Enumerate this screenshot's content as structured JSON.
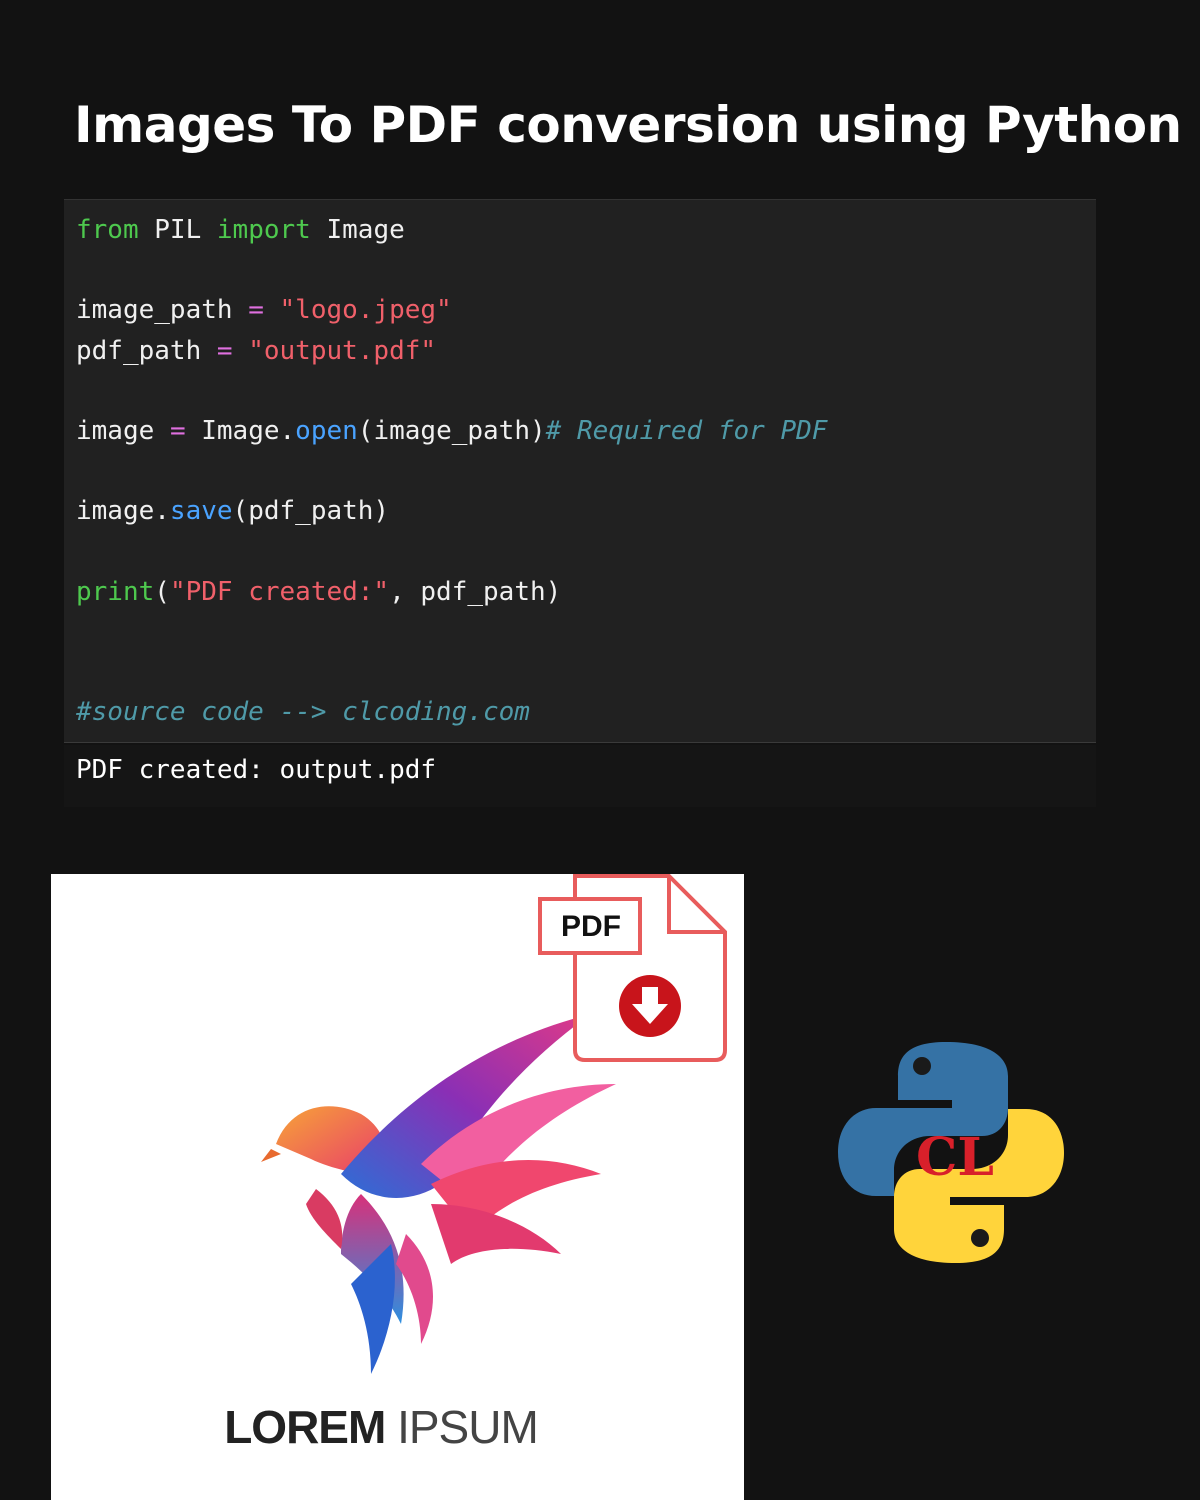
{
  "page": {
    "title": "Images To PDF conversion using Python"
  },
  "code_cell": {
    "lines": [
      {
        "tokens": [
          "from",
          "PIL",
          "import",
          "Image"
        ]
      },
      {
        "tokens": []
      },
      {
        "tokens": [
          "image_path",
          "=",
          "\"logo.jpeg\""
        ]
      },
      {
        "tokens": [
          "pdf_path",
          "=",
          "\"output.pdf\""
        ]
      },
      {
        "tokens": []
      },
      {
        "tokens": [
          "image",
          "=",
          "Image.",
          "open",
          "(image_path)",
          "# Required for PDF"
        ]
      },
      {
        "tokens": []
      },
      {
        "tokens": [
          "image.",
          "save",
          "(pdf_path)"
        ]
      },
      {
        "tokens": []
      },
      {
        "tokens": [
          "print",
          "(",
          "\"PDF created:\"",
          ", pdf_path)"
        ]
      },
      {
        "tokens": []
      },
      {
        "tokens": []
      },
      {
        "tokens": [
          "#source code --> clcoding.com"
        ]
      }
    ]
  },
  "output_cell": {
    "text": "PDF created: output.pdf"
  },
  "logo_card": {
    "brand_word_bold": "LOREM",
    "brand_word_light": "IPSUM",
    "pdf_badge": "PDF"
  },
  "python_logo": {
    "monogram": "CL"
  },
  "colors": {
    "background": "#121212",
    "code_bg": "#212121",
    "keyword": "#4ec94e",
    "string": "#f0606a",
    "operator": "#e070e0",
    "function": "#4aa3ff",
    "comment": "#4f9aa8",
    "pdf_red": "#e85c5c",
    "python_blue": "#3572a5",
    "python_yellow": "#ffd43b"
  }
}
